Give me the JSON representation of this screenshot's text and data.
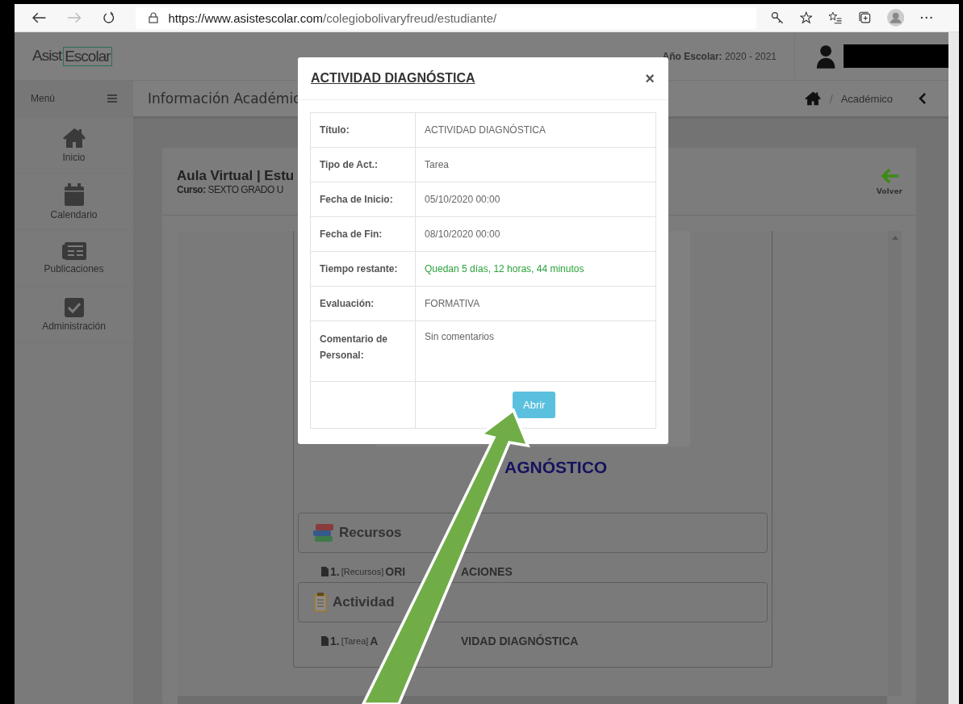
{
  "browser": {
    "url_host": "https://www.asistescolar.com",
    "url_path": "/colegiobolivaryfreud/estudiante/"
  },
  "header": {
    "logo_left": "Asist",
    "logo_right": "Escolar",
    "school_year_label": "Año Escolar:",
    "school_year": "2020 - 2021"
  },
  "sidebar": {
    "menu_label": "Menú",
    "items": [
      {
        "label": "Inicio"
      },
      {
        "label": "Calendario"
      },
      {
        "label": "Publicaciones"
      },
      {
        "label": "Administración"
      }
    ]
  },
  "breadcrumb_bar": {
    "title": "Información Académic",
    "separator": "/",
    "crumb": "Académico"
  },
  "card": {
    "title": "Aula Virtual | Estu",
    "course_label": "Curso:",
    "course": "SEXTO GRADO U",
    "back_label": "Volver"
  },
  "content": {
    "heading": "AGNÓSTICO",
    "sections": [
      {
        "title": "Recursos",
        "items": [
          {
            "number": "1.",
            "tag": "[Recursos]",
            "name_parts": [
              "ORI",
              "ACIONES"
            ]
          }
        ]
      },
      {
        "title": "Actividad",
        "items": [
          {
            "number": "1.",
            "tag": "[Tarea]",
            "name_parts": [
              "A",
              "VIDAD DIAGNÓSTICA"
            ]
          }
        ]
      }
    ]
  },
  "modal": {
    "title": "ACTIVIDAD DIAGNÓSTICA",
    "close": "×",
    "rows": [
      {
        "label": "Título:",
        "value": "ACTIVIDAD DIAGNÓSTICA",
        "kind": "text"
      },
      {
        "label": "Tipo de Act.:",
        "value": "Tarea",
        "kind": "text"
      },
      {
        "label": "Fecha de Inicio:",
        "value": "05/10/2020 00:00",
        "kind": "text"
      },
      {
        "label": "Fecha de Fin:",
        "value": "08/10/2020 00:00",
        "kind": "text"
      },
      {
        "label": "Tiempo restante:",
        "value": "Quedan 5 días, 12 horas, 44 minutos",
        "kind": "highlight"
      },
      {
        "label": "Evaluación:",
        "value": "FORMATIVA",
        "kind": "text"
      },
      {
        "label": "Comentario de Personal:",
        "value": "Sin comentarios",
        "kind": "tall"
      }
    ],
    "button": "Abrir"
  }
}
